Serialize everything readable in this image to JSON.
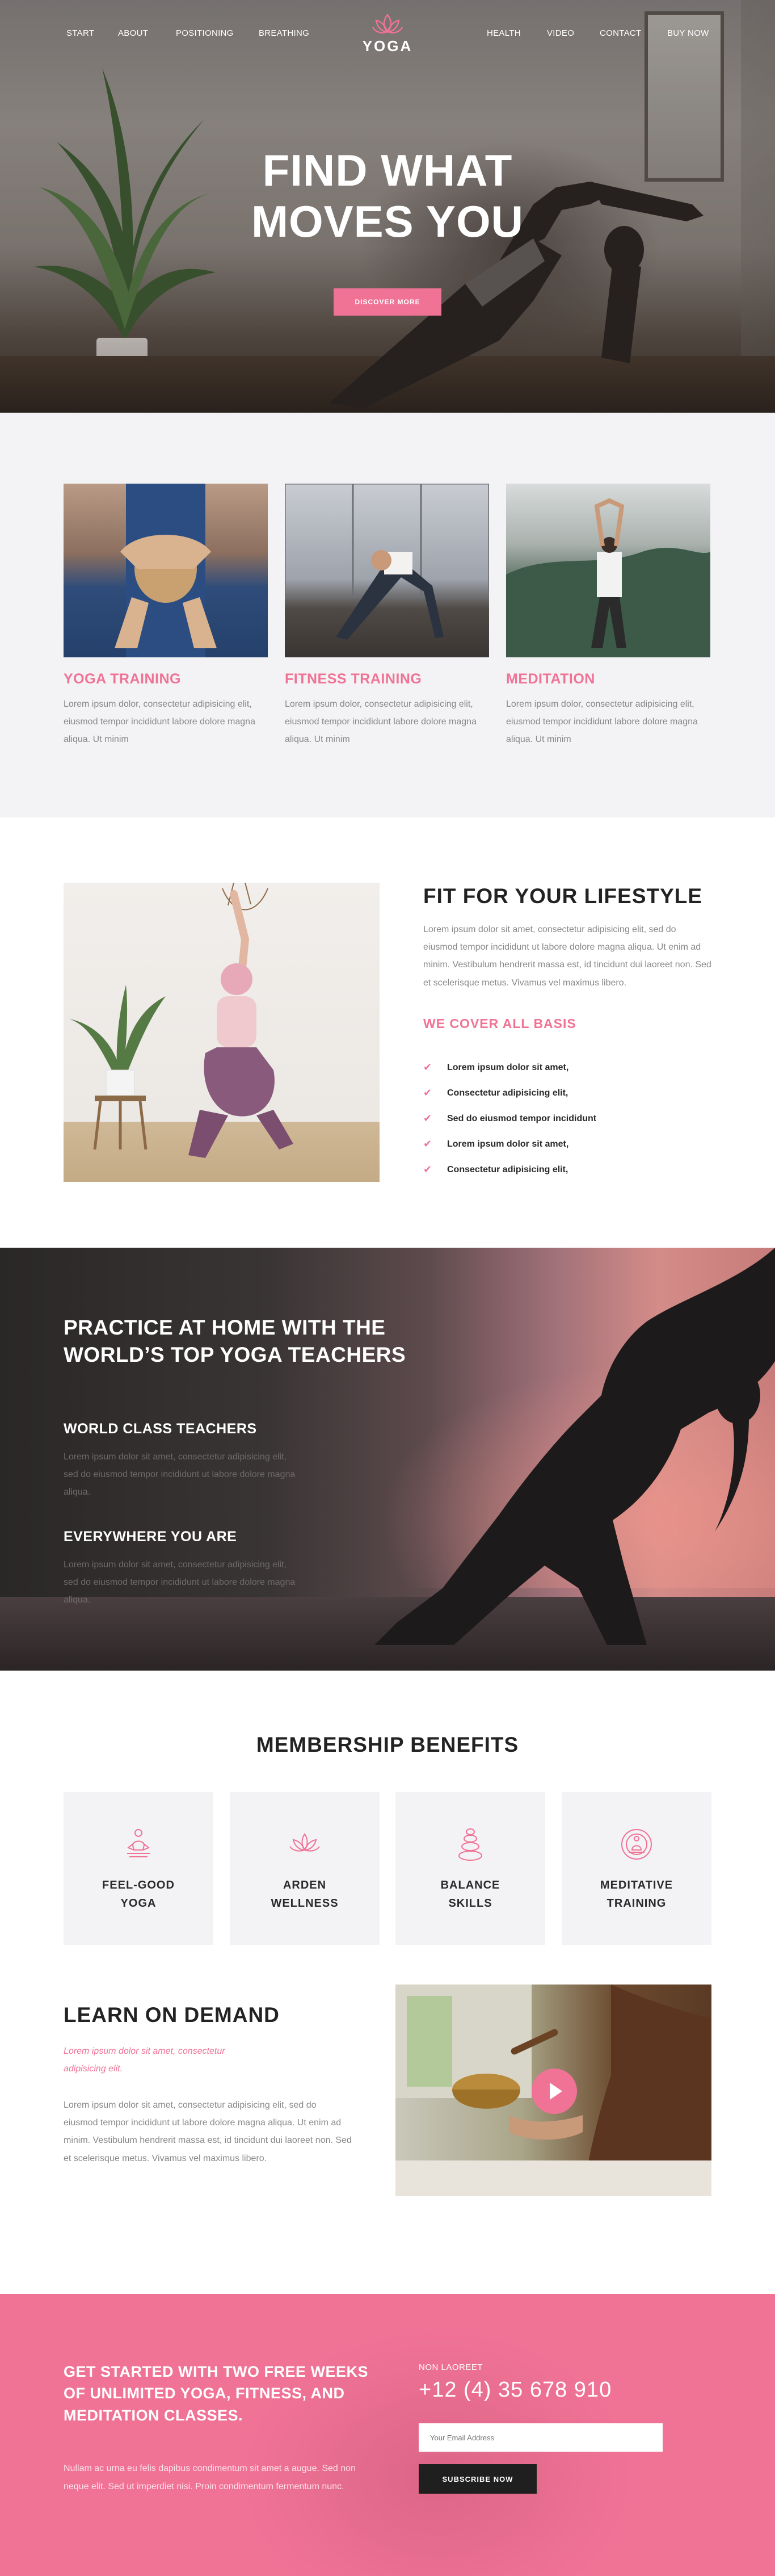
{
  "nav": {
    "left": [
      "START",
      "ABOUT",
      "POSITIONING",
      "BREATHING"
    ],
    "right": [
      "HEALTH",
      "VIDEO",
      "CONTACT",
      "BUY NOW"
    ],
    "logo_text": "YOGA"
  },
  "hero": {
    "title_line1": "FIND WHAT",
    "title_line2": "MOVES YOU",
    "button_label": "DISCOVER MORE"
  },
  "services": [
    {
      "title": "YOGA TRAINING",
      "text": "Lorem ipsum dolor, consectetur adipisicing elit, eiusmod tempor incididunt labore dolore magna aliqua. Ut minim"
    },
    {
      "title": "FITNESS TRAINING",
      "text": "Lorem ipsum dolor, consectetur adipisicing elit, eiusmod tempor incididunt labore dolore magna aliqua. Ut minim"
    },
    {
      "title": "MEDITATION",
      "text": "Lorem ipsum dolor, consectetur adipisicing elit, eiusmod tempor incididunt labore dolore magna aliqua. Ut minim"
    }
  ],
  "lifestyle": {
    "title": "FIT FOR YOUR LIFESTYLE",
    "lead": "Lorem ipsum dolor sit amet, consectetur adipisicing elit, sed do eiusmod  tempor incididunt ut labore dolore magna aliqua. Ut enim ad minim. Vestibulum hendrerit massa est, id tincidunt dui laoreet non. Sed et scelerisque metus. Vivamus vel maximus libero.",
    "subtitle": "WE COVER ALL BASIS",
    "checklist": [
      "Lorem ipsum dolor sit amet,",
      "Consectetur adipisicing elit,",
      "Sed do eiusmod tempor incididunt",
      "Lorem ipsum dolor sit amet,",
      "Consectetur adipisicing elit,"
    ]
  },
  "practice": {
    "title": "PRACTICE AT HOME WITH THE WORLD’S TOP YOGA TEACHERS",
    "h1": "WORLD CLASS TEACHERS",
    "p1": "Lorem ipsum dolor sit amet, consectetur adipisicing elit, sed do eiusmod tempor incididunt ut labore dolore magna aliqua.",
    "h2": "EVERYWHERE YOU ARE",
    "p2": "Lorem ipsum dolor sit amet, consectetur adipisicing elit, sed do eiusmod tempor incididunt ut labore dolore magna aliqua."
  },
  "membership": {
    "title": "MEMBERSHIP BENEFITS",
    "items": [
      {
        "label": "FEEL-GOOD YOGA",
        "icon": "meditating-person-icon"
      },
      {
        "label": "ARDEN WELLNESS",
        "icon": "lotus-icon"
      },
      {
        "label": "BALANCE SKILLS",
        "icon": "stacked-stones-icon"
      },
      {
        "label": "MEDITATIVE TRAINING",
        "icon": "meditation-sun-icon"
      }
    ]
  },
  "learn": {
    "title": "LEARN ON DEMAND",
    "quote": "Lorem ipsum dolor sit amet, consectetur adipisicing elit.",
    "body": "Lorem ipsum dolor sit amet, consectetur adipisicing elit, sed do eiusmod  tempor incididunt ut labore dolore magna aliqua. Ut enim ad minim. Vestibulum hendrerit massa est, id tincidunt dui laoreet non. Sed et scelerisque metus. Vivamus vel maximus libero."
  },
  "cta": {
    "title": "GET STARTED WITH TWO FREE WEEKS OF UNLIMITED YOGA, FITNESS, AND MEDITATION CLASSES.",
    "text": "Nullam ac urna eu felis dapibus condimentum sit amet a augue. Sed non neque elit.  Sed ut imperdiet nisi. Proin condimentum fermentum nunc.",
    "small_label": "NON LAOREET",
    "phone": "+12 (4) 35 678 910",
    "email_placeholder": "Your Email Address",
    "button_label": "SUBSCRIBE NOW"
  },
  "colors": {
    "accent": "#f07396",
    "dark": "#1f1f1f",
    "light_bg": "#f3f2f5"
  }
}
